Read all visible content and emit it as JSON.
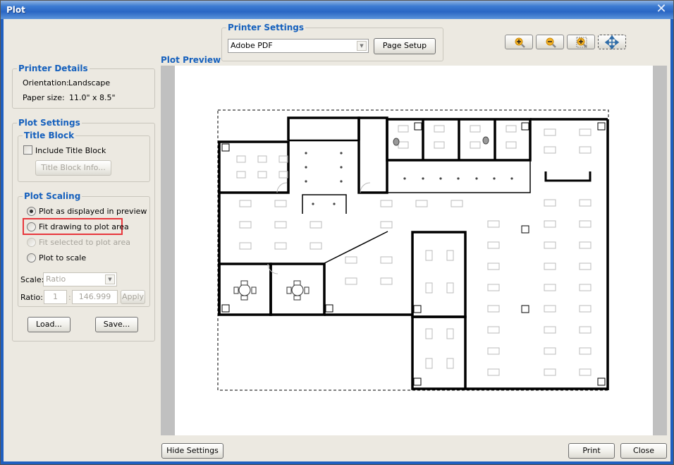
{
  "window": {
    "title": "Plot",
    "close_icon": "close-icon"
  },
  "printer_details": {
    "heading": "Printer Details",
    "orientation_label": "Orientation:",
    "orientation_value": "Landscape",
    "paper_size_label": "Paper size:",
    "paper_size_value": "11.0\" x 8.5\""
  },
  "plot_settings": {
    "heading": "Plot Settings",
    "title_block": {
      "heading": "Title Block",
      "include_label": "Include Title Block",
      "include_checked": false,
      "info_button": "Title Block Info..."
    },
    "plot_scaling": {
      "heading": "Plot Scaling",
      "options": [
        {
          "label": "Plot as displayed in preview",
          "selected": true,
          "enabled": true
        },
        {
          "label": "Fit drawing to plot area",
          "selected": false,
          "enabled": true,
          "highlighted": true
        },
        {
          "label": "Fit selected to plot area",
          "selected": false,
          "enabled": false
        },
        {
          "label": "Plot to scale",
          "selected": false,
          "enabled": true
        }
      ],
      "scale_label": "Scale:",
      "scale_value": "Ratio",
      "ratio_label": "Ratio:",
      "ratio_left": "1",
      "ratio_sep": ":",
      "ratio_right": "146.999",
      "apply_button": "Apply"
    },
    "load_button": "Load...",
    "save_button": "Save..."
  },
  "printer_settings": {
    "heading": "Printer Settings",
    "printer_value": "Adobe PDF",
    "page_setup_button": "Page Setup"
  },
  "zoom_toolbar": [
    {
      "name": "zoom-in",
      "icon": "zoom-in-icon"
    },
    {
      "name": "zoom-out",
      "icon": "zoom-out-icon"
    },
    {
      "name": "zoom-window",
      "icon": "zoom-window-icon"
    },
    {
      "name": "pan",
      "icon": "pan-icon",
      "active": true
    }
  ],
  "preview": {
    "heading": "Plot Preview"
  },
  "footer": {
    "hide_settings_button": "Hide Settings",
    "print_button": "Print",
    "close_button": "Close"
  }
}
